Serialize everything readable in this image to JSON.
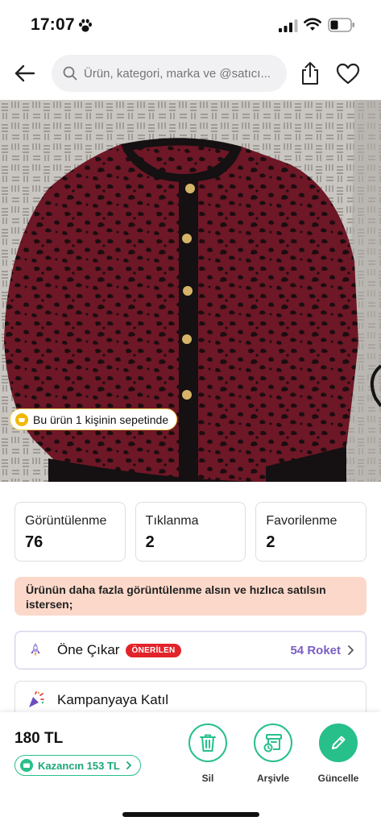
{
  "status_bar": {
    "time": "17:07"
  },
  "search": {
    "placeholder": "Ürün, kategori, marka ve @satıcı..."
  },
  "product": {
    "basket_badge": "Bu ürün 1 kişinin sepetinde"
  },
  "stats": [
    {
      "label": "Görüntülenme",
      "value": "76"
    },
    {
      "label": "Tıklanma",
      "value": "2"
    },
    {
      "label": "Favorilenme",
      "value": "2"
    }
  ],
  "promo": {
    "text": "Ürünün daha fazla görüntülenme alsın ve hızlıca satılsın istersen;"
  },
  "options": {
    "featured": {
      "label": "Öne Çıkar",
      "badge": "ÖNERİLEN",
      "right_text": "54 Roket"
    },
    "campaign": {
      "label": "Kampanyaya Katıl"
    }
  },
  "bottom": {
    "price": "180 TL",
    "earn": "Kazancın 153 TL",
    "actions": {
      "delete": "Sil",
      "archive": "Arşivle",
      "update": "Güncelle"
    }
  },
  "colors": {
    "accent_green": "#28c08a",
    "badge_red": "#e2232a",
    "promo_bg": "#fbd8c9",
    "rocket_purple": "#7a5fc4"
  }
}
